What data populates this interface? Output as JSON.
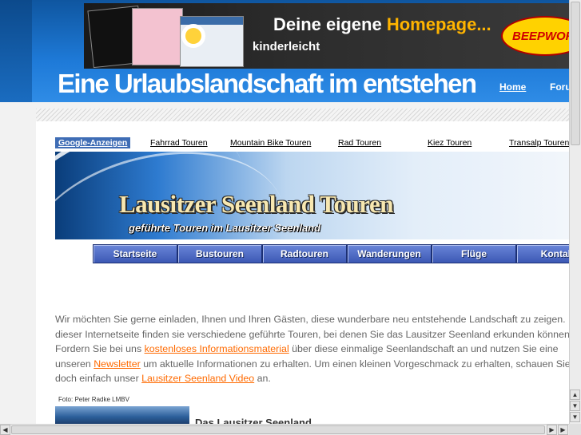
{
  "banner_ad": {
    "headline_prefix": "Deine eigene ",
    "headline_highlight": "Homepage...",
    "subline": "kinderleicht",
    "logo": "BEEPWORLD"
  },
  "header": {
    "title": "Eine Urlaubslandschaft im entstehen",
    "nav": [
      "Home",
      "Foru"
    ]
  },
  "ads": {
    "label": "Google-Anzeigen",
    "links": [
      "Fahrrad Touren",
      "Mountain Bike Touren",
      "Rad Touren",
      "Kiez Touren",
      "Transalp Touren"
    ]
  },
  "tour_banner": {
    "title": "Lausitzer Seenland Touren",
    "subtitle": "geführte Touren im Lausitzer Seenland"
  },
  "menu": [
    "Startseite",
    "Bustouren",
    "Radtouren",
    "Wanderungen",
    "Flüge",
    "Kontakt"
  ],
  "intro": {
    "line1": "Wir möchten Sie gerne einladen, Ihnen und Ihren Gästen, diese wunderbare neu entstehende Landschaft zu zeigen.",
    "line2": "dieser Internetseite finden sie verschiedene geführte Touren, bei denen Sie das Lausitzer Seenland erkunden können.",
    "line3_pre": "Fordern Sie bei uns ",
    "line3_link": "kostenloses Informationsmaterial",
    "line3_post": " über diese einmalige Seenlandschaft an und nutzen Sie eine",
    "line4_pre": "unseren ",
    "line4_link": "Newsletter",
    "line4_post": " um aktuelle Informationen zu erhalten. Um einen kleinen Vorgeschmack zu erhalten, schauen Sie",
    "line5_pre": "doch einfach unser ",
    "line5_link": "Lausitzer Seenland Video",
    "line5_post": " an."
  },
  "photo": {
    "caption": "Foto: Peter Radke LMBV",
    "title": "Das Lausitzer Seenland"
  },
  "colors": {
    "header_blue": "#1e7ad8",
    "menu_blue": "#3c58b4",
    "link_orange": "#ff6a00",
    "ad_label_bg": "#3f6db5"
  }
}
